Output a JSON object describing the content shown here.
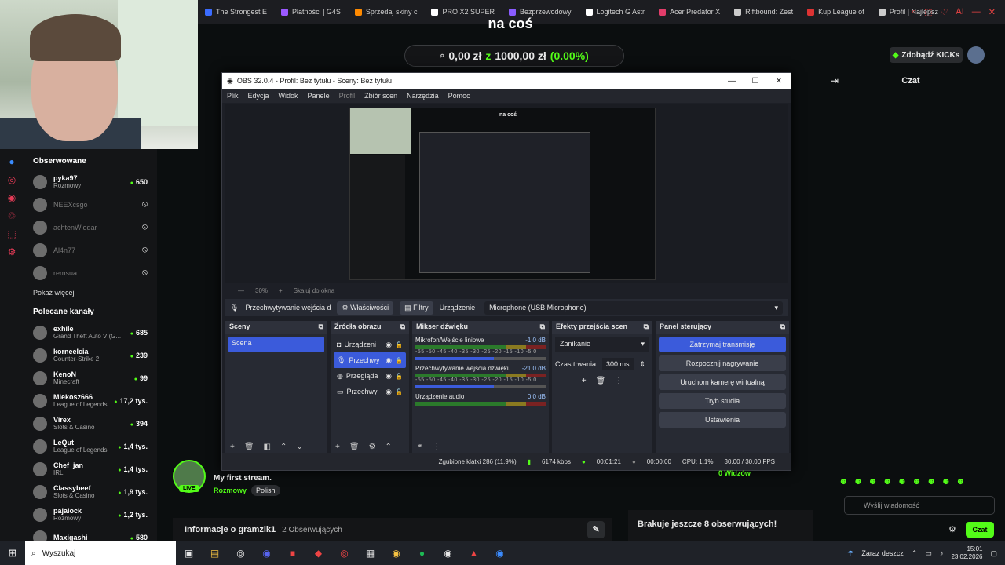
{
  "browser": {
    "tabs": [
      {
        "label": "The Strongest E",
        "color": "#3b6cff"
      },
      {
        "label": "Płatności | G4S",
        "color": "#9b59ff"
      },
      {
        "label": "Sprzedaj skiny c",
        "color": "#ff8a00"
      },
      {
        "label": "PRO X2 SUPER",
        "color": "#ffffff"
      },
      {
        "label": "Bezprzewodowy",
        "color": "#8a5cff"
      },
      {
        "label": "Logitech G Astr",
        "color": "#ffffff"
      },
      {
        "label": "Acer Predator X",
        "color": "#e23d6a"
      },
      {
        "label": "Riftbound: Zest",
        "color": "#cccccc"
      },
      {
        "label": "Kup League of",
        "color": "#d33"
      },
      {
        "label": "Profil | Najlepsz",
        "color": "#cccccc"
      }
    ],
    "ai_label": "AI"
  },
  "goal": {
    "title": "na coś",
    "current": "0,00 zł",
    "separator": "z",
    "target": "1000,00 zł",
    "percent": "(0.00%)"
  },
  "header": {
    "kicks_button": "Zdobądź KICKs"
  },
  "chat": {
    "title": "Czat",
    "placeholder": "Wyślij wiadomość",
    "send_label": "Czat"
  },
  "sidebar": {
    "followed_title": "Obserwowane",
    "followed": [
      {
        "name": "pyka97",
        "category": "Rozmowy",
        "viewers": "650",
        "live": true
      },
      {
        "name": "NEEXcsgo",
        "category": "",
        "viewers": "",
        "live": false
      },
      {
        "name": "achtenWlodar",
        "category": "",
        "viewers": "",
        "live": false
      },
      {
        "name": "Al4n77",
        "category": "",
        "viewers": "",
        "live": false
      },
      {
        "name": "remsua",
        "category": "",
        "viewers": "",
        "live": false
      }
    ],
    "show_more": "Pokaż więcej",
    "recommended_title": "Polecane kanały",
    "recommended": [
      {
        "name": "exhile",
        "category": "Grand Theft Auto V (G...",
        "viewers": "685"
      },
      {
        "name": "korneelcia",
        "category": "Counter-Strike 2",
        "viewers": "239"
      },
      {
        "name": "KenoN",
        "category": "Minecraft",
        "viewers": "99"
      },
      {
        "name": "Mlekosz666",
        "category": "League of Legends",
        "viewers": "17,2 tys."
      },
      {
        "name": "Virex",
        "category": "Slots & Casino",
        "viewers": "394"
      },
      {
        "name": "LeQut",
        "category": "League of Legends",
        "viewers": "1,4 tys."
      },
      {
        "name": "Chef_jan",
        "category": "IRL",
        "viewers": "1,4 tys."
      },
      {
        "name": "Classybeef",
        "category": "Slots & Casino",
        "viewers": "1,9 tys."
      },
      {
        "name": "pajalock",
        "category": "Rozmowy",
        "viewers": "1,2 tys."
      },
      {
        "name": "Maxigashi",
        "category": "",
        "viewers": "580"
      }
    ]
  },
  "obs": {
    "title": "OBS 32.0.4 - Profil: Bez tytułu - Sceny: Bez tytułu",
    "menu": [
      "Plik",
      "Edycja",
      "Widok",
      "Panele",
      "Profil",
      "Zbiór scen",
      "Narzędzia",
      "Pomoc"
    ],
    "preview_mini_title": "na coś",
    "zoom": "30%",
    "fit_label": "Skaluj do okna",
    "source_name": "Przechwytywanie wejścia d",
    "properties": "Właściwości",
    "filters": "Filtry",
    "device_label": "Urządzenie",
    "device_value": "Microphone (USB Microphone)",
    "docks": {
      "scenes": "Sceny",
      "sources": "Źródła obrazu",
      "mixer": "Mikser dźwięku",
      "transitions": "Efekty przejścia scen",
      "controls": "Panel sterujący"
    },
    "scenes": [
      "Scena"
    ],
    "sources": [
      {
        "name": "Urządzeni",
        "icon": "camera-icon"
      },
      {
        "name": "Przechwy",
        "icon": "microphone-icon",
        "selected": true
      },
      {
        "name": "Przegląda",
        "icon": "globe-icon"
      },
      {
        "name": "Przechwy",
        "icon": "monitor-icon"
      }
    ],
    "mixer": [
      {
        "name": "Mikrofon/Wejście liniowe",
        "db": "-1.0 dB"
      },
      {
        "name": "Przechwytywanie wejścia dźwięku",
        "db": "-21.0 dB"
      },
      {
        "name": "Urządzenie audio",
        "db": "0.0 dB"
      }
    ],
    "mixer_scale": "-55 -50 -45 -40 -35 -30 -25 -20 -15 -10 -5 0",
    "transition": "Zanikanie",
    "duration_label": "Czas trwania",
    "duration_value": "300 ms",
    "controls": [
      "Zatrzymaj transmisję",
      "Rozpocznij nagrywanie",
      "Uruchom kamerę wirtualną",
      "Tryb studia",
      "Ustawienia"
    ],
    "status": {
      "dropped": "Zgubione klatki 286 (11.9%)",
      "bitrate": "6174 kbps",
      "live_time": "00:01:21",
      "rec_time": "00:00:00",
      "cpu": "CPU: 1.1%",
      "fps": "30.00 / 30.00 FPS"
    }
  },
  "stream": {
    "live_badge": "LIVE",
    "title": "My first stream.",
    "category": "Rozmowy",
    "language": "Polish",
    "viewers": "0 Widzów",
    "about_title": "Informacje o gramzik1",
    "about_followers": "2 Obserwujących",
    "followers_needed": "Brakuje jeszcze 8 obserwujących!"
  },
  "taskbar": {
    "search_placeholder": "Wyszukaj",
    "weather": "Zaraz deszcz",
    "time": "15:01",
    "date": "23.02.2026"
  }
}
